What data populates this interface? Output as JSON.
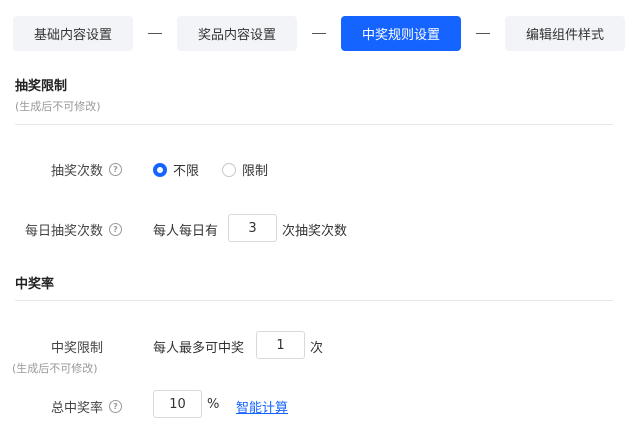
{
  "steps": [
    {
      "label": "基础内容设置",
      "active": false
    },
    {
      "label": "奖品内容设置",
      "active": false
    },
    {
      "label": "中奖规则设置",
      "active": true
    },
    {
      "label": "编辑组件样式",
      "active": false
    }
  ],
  "section_draw": {
    "title": "抽奖限制",
    "subtitle": "(生成后不可修改)",
    "draw_times": {
      "label": "抽奖次数",
      "options": [
        "不限",
        "限制"
      ],
      "selected": "不限"
    },
    "daily_draw": {
      "label": "每日抽奖次数",
      "prefix": "每人每日有",
      "value": "3",
      "suffix": "次抽奖次数"
    }
  },
  "section_win": {
    "title": "中奖率",
    "win_limit": {
      "label": "中奖限制",
      "note": "(生成后不可修改)",
      "prefix": "每人最多可中奖",
      "value": "1",
      "suffix": "次"
    },
    "total_rate": {
      "label": "总中奖率",
      "value": "10",
      "unit": "%",
      "link": "智能计算"
    }
  },
  "colors": {
    "accent": "#1664ff",
    "step_bg": "#f3f4f8",
    "muted": "#999999"
  }
}
